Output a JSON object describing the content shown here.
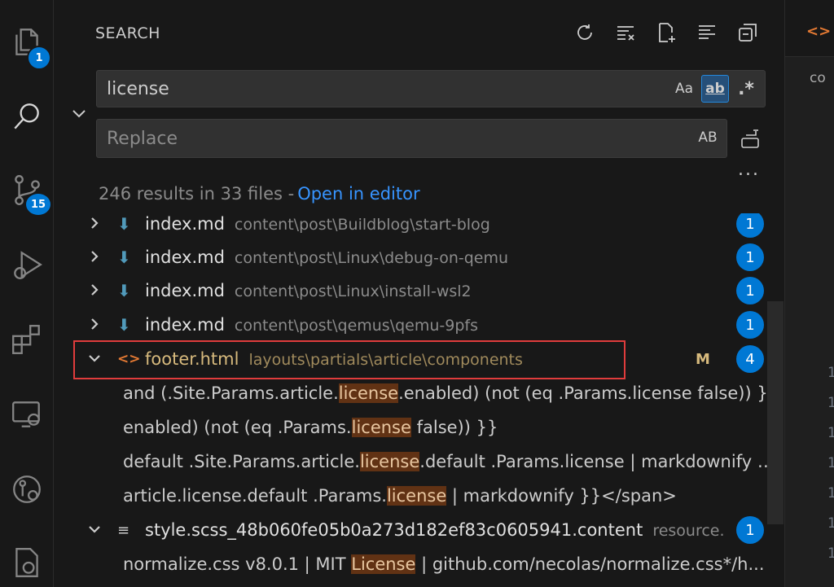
{
  "activity_bar": {
    "explorer_badge": "1",
    "scm_badge": "15"
  },
  "panel": {
    "title": "SEARCH"
  },
  "search": {
    "value": "license",
    "case_label": "Aa",
    "word_label": "ab",
    "regex_label": ".*"
  },
  "replace": {
    "placeholder": "Replace",
    "preserve_case_label": "AB"
  },
  "more_label": "...",
  "summary": {
    "text": "246 results in 33 files -",
    "link": "Open in editor"
  },
  "results": {
    "files": [
      {
        "name": "index.md",
        "path": "content\\post\\Buildblog\\start-blog",
        "count": "1"
      },
      {
        "name": "index.md",
        "path": "content\\post\\Linux\\debug-on-qemu",
        "count": "1"
      },
      {
        "name": "index.md",
        "path": "content\\post\\Linux\\install-wsl2",
        "count": "1"
      },
      {
        "name": "index.md",
        "path": "content\\post\\qemus\\qemu-9pfs",
        "count": "1"
      },
      {
        "name": "footer.html",
        "path": "layouts\\partials\\article\\components",
        "status": "M",
        "count": "4"
      },
      {
        "name": "style.scss_48b060fe05b0a273d182ef83c0605941.content",
        "path": "resource...",
        "count": "1"
      }
    ],
    "matches": [
      {
        "before": "and (.Site.Params.article.",
        "hit": "license",
        "after": ".enabled) (not (eq .Params.license false)) }}"
      },
      {
        "before": "enabled) (not (eq .Params.",
        "hit": "license",
        "after": " false)) }}"
      },
      {
        "before": "default .Site.Params.article.",
        "hit": "license",
        "after": ".default .Params.license | markdownify }..."
      },
      {
        "before": "article.license.default .Params.",
        "hit": "license",
        "after": " | markdownify }}</span>"
      },
      {
        "before": "normalize.css v8.0.1 | MIT ",
        "hit": "License",
        "after": " | github.com/necolas/normalize.css*/h..."
      }
    ]
  },
  "editor": {
    "crumb": "co",
    "line_numbers": [
      "1",
      "1",
      "1",
      "1",
      "1",
      "1",
      "1"
    ]
  },
  "colors": {
    "accent": "#0078d4",
    "highlight": "#613214",
    "selection_outline": "#e03c3c",
    "modified": "#d7ba7d"
  }
}
